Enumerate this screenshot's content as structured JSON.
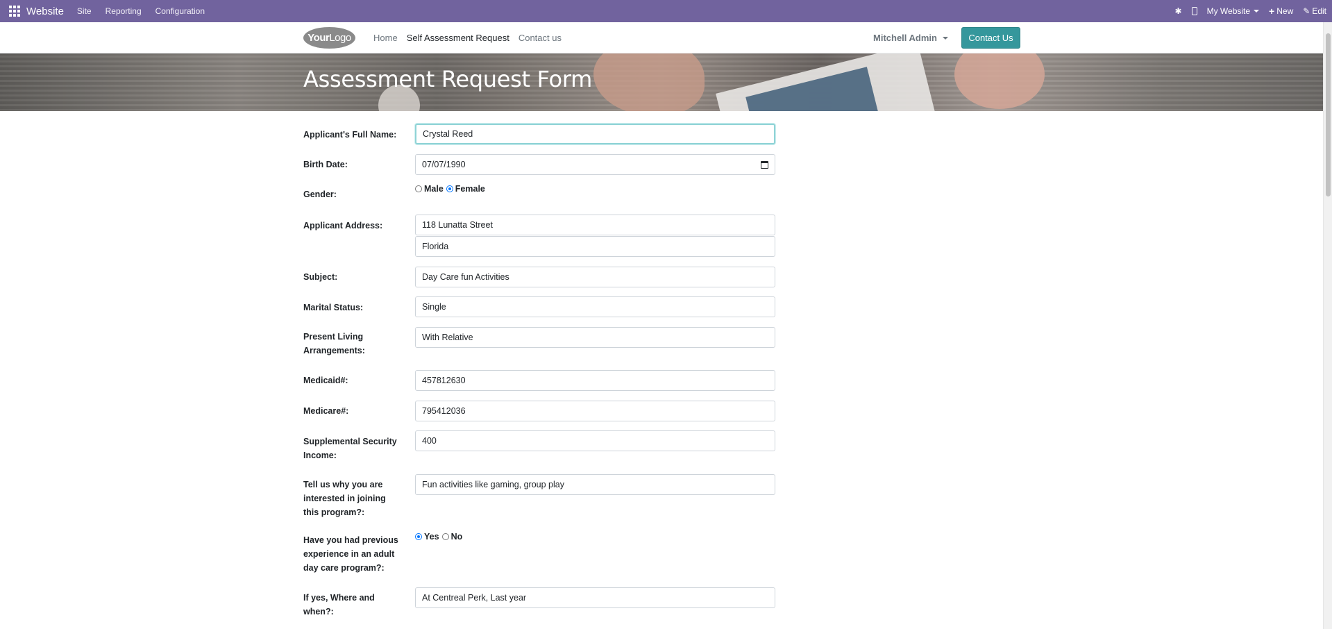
{
  "adminbar": {
    "brand": "Website",
    "menus": [
      "Site",
      "Reporting",
      "Configuration"
    ],
    "website_selector": "My Website",
    "new_label": "New",
    "edit_label": "Edit",
    "bg_color": "#71639e"
  },
  "header": {
    "logo": "YourLogo",
    "nav": [
      "Home",
      "Self Assessment Request",
      "Contact us"
    ],
    "active_nav": "Self Assessment Request",
    "user": "Mitchell Admin",
    "contact_button": "Contact Us",
    "accent_color": "#35979c"
  },
  "banner": {
    "title": "Assessment Request Form"
  },
  "form": {
    "full_name": {
      "label": "Applicant's Full Name:",
      "value": "Crystal Reed"
    },
    "birth_date": {
      "label": "Birth Date:",
      "value": "07/07/1990"
    },
    "gender": {
      "label": "Gender:",
      "options": [
        "Male",
        "Female"
      ],
      "selected": "Female"
    },
    "address": {
      "label": "Applicant Address:",
      "line1": "118 Lunatta Street",
      "line2": "Florida"
    },
    "subject": {
      "label": "Subject:",
      "value": "Day Care fun Activities"
    },
    "marital_status": {
      "label": "Marital Status:",
      "value": "Single"
    },
    "living": {
      "label": "Present Living Arrangements:",
      "value": "With Relative"
    },
    "medicaid": {
      "label": "Medicaid#:",
      "value": "457812630"
    },
    "medicare": {
      "label": "Medicare#:",
      "value": "795412036"
    },
    "ssi": {
      "label": "Supplemental Security Income:",
      "value": "400"
    },
    "why": {
      "label": "Tell us why you are interested in joining this program?:",
      "value": "Fun activities like gaming, group play"
    },
    "previous": {
      "label": "Have you had previous experience in an adult day care program?:",
      "options": [
        "Yes",
        "No"
      ],
      "selected": "Yes"
    },
    "where_when": {
      "label": "If yes, Where and when?:",
      "value": "At Centreal Perk, Last year"
    }
  }
}
